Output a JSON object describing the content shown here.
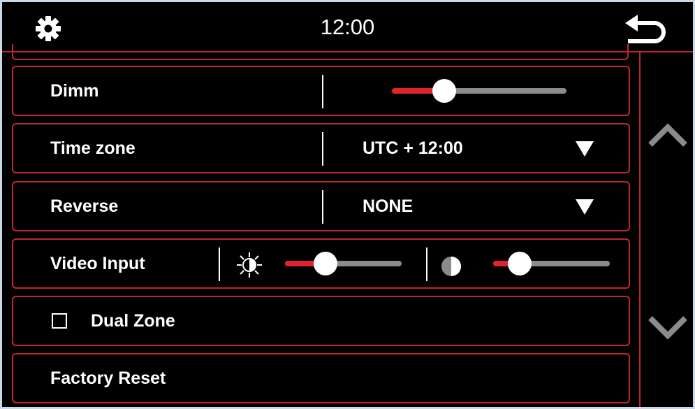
{
  "header": {
    "time": "12:00",
    "settings_icon": "gear-icon",
    "back_icon": "back-arrow-icon"
  },
  "rows": {
    "dimm": {
      "label": "Dimm",
      "level": 0.3
    },
    "timezone": {
      "label": "Time zone",
      "value": "UTC + 12:00"
    },
    "reverse": {
      "label": "Reverse",
      "value": "NONE"
    },
    "video_input": {
      "label": "Video Input",
      "brightness_level": 0.35,
      "contrast_level": 0.23
    },
    "dual_zone": {
      "label": "Dual Zone",
      "checked": false
    },
    "factory_reset": {
      "label": "Factory Reset"
    }
  },
  "scroll": {
    "up_icon": "chevron-up-icon",
    "down_icon": "chevron-down-icon"
  },
  "colors": {
    "accent": "#c0272d",
    "slider_fill": "#e0242c",
    "track": "#8b8b8b",
    "background": "#000000"
  }
}
